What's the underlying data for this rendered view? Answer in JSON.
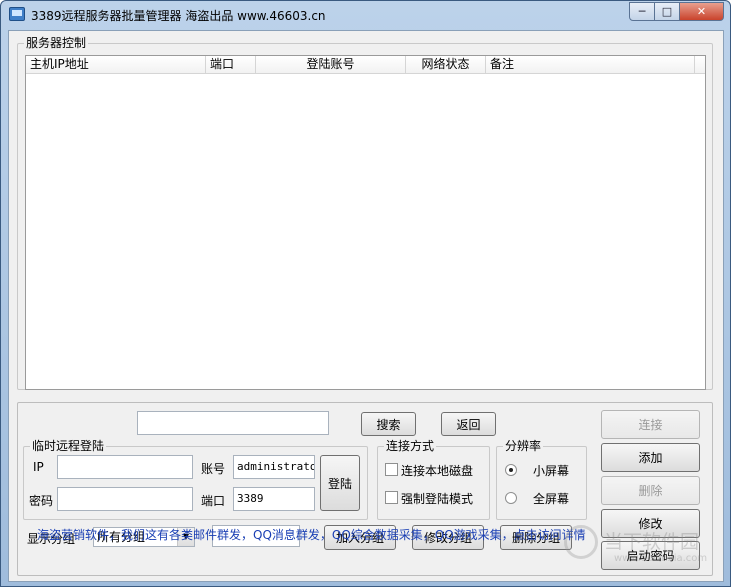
{
  "window": {
    "title": "3389远程服务器批量管理器 海盗出品 www.46603.cn",
    "minimize": "─",
    "maximize": "□",
    "close": "✕"
  },
  "server_panel": {
    "title": "服务器控制",
    "columns": [
      "主机IP地址",
      "端口",
      "登陆账号",
      "网络状态",
      "备注"
    ],
    "rows": []
  },
  "search": {
    "value": "",
    "search_label": "搜索",
    "back_label": "返回"
  },
  "temp_login": {
    "title": "临时远程登陆",
    "ip_label": "IP",
    "ip_value": "",
    "password_label": "密码",
    "password_value": "",
    "account_label": "账号",
    "account_value": "administrator",
    "port_label": "端口",
    "port_value": "3389",
    "login_label": "登陆"
  },
  "connect_mode": {
    "title": "连接方式",
    "local_disk": "连接本地磁盘",
    "force_login": "强制登陆模式"
  },
  "resolution": {
    "title": "分辨率",
    "small": "小屏幕",
    "full": "全屏幕",
    "selected": "small"
  },
  "group": {
    "label": "显示分组",
    "selected": "所有分组",
    "name_value": "",
    "add_label": "加入分组",
    "edit_label": "修改分组",
    "delete_label": "删除分组"
  },
  "side_buttons": {
    "connect": "连接",
    "add": "添加",
    "delete": "删除",
    "edit": "修改",
    "start_pw": "启动密码"
  },
  "footer": {
    "link": "海盗营销软件，我们这有各类邮件群发，QQ消息群发，QQ综合数据采集，QQ游戏采集，点击访问详情"
  },
  "watermark": {
    "text": "当下软件园",
    "url": "www.downxia.com"
  },
  "colors": {
    "link": "#1a3fb4",
    "title_bar": "#bcd2ea"
  }
}
